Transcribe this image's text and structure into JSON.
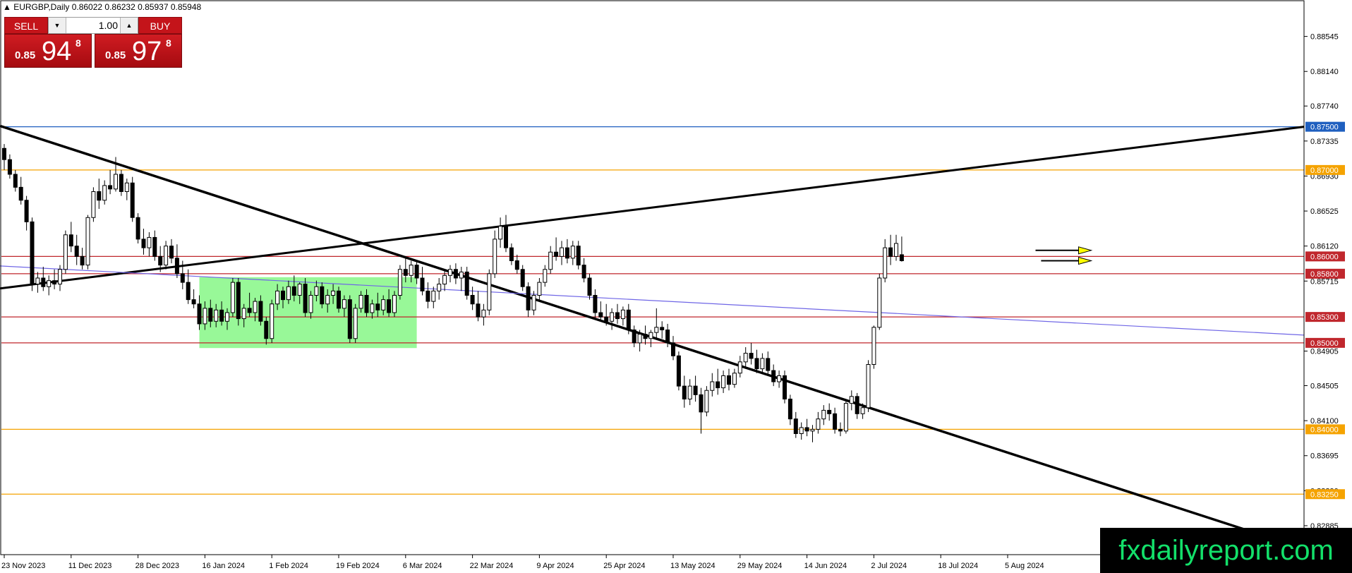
{
  "header": {
    "symbol_line": "EURGBP,Daily  0.86022 0.86232 0.85937 0.85948"
  },
  "trade_panel": {
    "sell_label": "SELL",
    "buy_label": "BUY",
    "lot_value": "1.00",
    "sell_price": {
      "prefix": "0.85",
      "big": "94",
      "sup": "8"
    },
    "buy_price": {
      "prefix": "0.85",
      "big": "97",
      "sup": "8"
    }
  },
  "watermark": "fxdailyreport.com",
  "colors": {
    "bull_body": "#ffffff",
    "bear_body": "#000000",
    "horizontal_red": "#c0272d",
    "horizontal_orange": "#f5a300",
    "horizontal_blue": "#1f5fbf",
    "trend_blue": "#6f66e6",
    "zone_green": "#98f898",
    "arrow_yellow": "#ffff00"
  },
  "chart_data": {
    "type": "candlestick",
    "symbol": "EURGBP",
    "timeframe": "Daily",
    "ylim": [
      0.8255,
      0.8895
    ],
    "y_ticks": [
      "0.88545",
      "0.88140",
      "0.87740",
      "0.87335",
      "0.86930",
      "0.86525",
      "0.86120",
      "0.85715",
      "0.84905",
      "0.84505",
      "0.84100",
      "0.83695",
      "0.83290",
      "0.82885"
    ],
    "x_ticks": [
      {
        "label": "23 Nov 2023",
        "bar": 0
      },
      {
        "label": "11 Dec 2023",
        "bar": 12
      },
      {
        "label": "28 Dec 2023",
        "bar": 24
      },
      {
        "label": "16 Jan 2024",
        "bar": 36
      },
      {
        "label": "1 Feb 2024",
        "bar": 48
      },
      {
        "label": "19 Feb 2024",
        "bar": 60
      },
      {
        "label": "6 Mar 2024",
        "bar": 72
      },
      {
        "label": "22 Mar 2024",
        "bar": 84
      },
      {
        "label": "9 Apr 2024",
        "bar": 96
      },
      {
        "label": "25 Apr 2024",
        "bar": 108
      },
      {
        "label": "13 May 2024",
        "bar": 120
      },
      {
        "label": "29 May 2024",
        "bar": 132
      },
      {
        "label": "14 Jun 2024",
        "bar": 144
      },
      {
        "label": "2 Jul 2024",
        "bar": 156
      },
      {
        "label": "18 Jul 2024",
        "bar": 168
      },
      {
        "label": "5 Aug 2024",
        "bar": 180
      }
    ],
    "horizontal_levels": [
      {
        "value": 0.875,
        "label": "0.87500",
        "color": "#1f5fbf"
      },
      {
        "value": 0.87,
        "label": "0.87000",
        "color": "#f5a300"
      },
      {
        "value": 0.86,
        "label": "0.86000",
        "color": "#c0272d"
      },
      {
        "value": 0.858,
        "label": "0.85800",
        "color": "#c0272d"
      },
      {
        "value": 0.853,
        "label": "0.85300",
        "color": "#c0272d"
      },
      {
        "value": 0.85,
        "label": "0.85000",
        "color": "#c0272d"
      },
      {
        "value": 0.84,
        "label": "0.84000",
        "color": "#f5a300"
      },
      {
        "value": 0.8325,
        "label": "0.83250",
        "color": "#f5a300"
      }
    ],
    "trendlines": [
      {
        "color": "#000000",
        "width": 3.5,
        "from": [
          0,
          0.8751
        ],
        "to": [
          1840,
          0.8264
        ]
      },
      {
        "color": "#000000",
        "width": 3,
        "from": [
          0,
          0.8563
        ],
        "to": [
          1848,
          0.875
        ]
      },
      {
        "color": "#6f66e6",
        "width": 1.2,
        "from": [
          0,
          0.8589
        ],
        "to": [
          1848,
          0.8509
        ]
      }
    ],
    "zone": {
      "from_bar": 35,
      "to_bar": 74,
      "top": 0.8576,
      "bottom": 0.8494
    },
    "arrows": [
      {
        "from_bar": 185,
        "to_bar": 195,
        "value": 0.8607
      },
      {
        "from_bar": 186,
        "to_bar": 195,
        "value": 0.8595
      }
    ],
    "candles": [
      {
        "o": 0.8725,
        "h": 0.873,
        "l": 0.87,
        "c": 0.8712
      },
      {
        "o": 0.8712,
        "h": 0.8718,
        "l": 0.869,
        "c": 0.8695
      },
      {
        "o": 0.8695,
        "h": 0.87,
        "l": 0.8675,
        "c": 0.868
      },
      {
        "o": 0.868,
        "h": 0.8692,
        "l": 0.866,
        "c": 0.8665
      },
      {
        "o": 0.8665,
        "h": 0.867,
        "l": 0.863,
        "c": 0.864
      },
      {
        "o": 0.864,
        "h": 0.8645,
        "l": 0.856,
        "c": 0.8568
      },
      {
        "o": 0.8568,
        "h": 0.8582,
        "l": 0.8558,
        "c": 0.8575
      },
      {
        "o": 0.8575,
        "h": 0.8588,
        "l": 0.856,
        "c": 0.8565
      },
      {
        "o": 0.8565,
        "h": 0.8578,
        "l": 0.8555,
        "c": 0.8572
      },
      {
        "o": 0.8572,
        "h": 0.8585,
        "l": 0.8562,
        "c": 0.8568
      },
      {
        "o": 0.8568,
        "h": 0.859,
        "l": 0.856,
        "c": 0.8585
      },
      {
        "o": 0.8585,
        "h": 0.863,
        "l": 0.858,
        "c": 0.8625
      },
      {
        "o": 0.8625,
        "h": 0.864,
        "l": 0.8605,
        "c": 0.8612
      },
      {
        "o": 0.8612,
        "h": 0.8625,
        "l": 0.859,
        "c": 0.86
      },
      {
        "o": 0.86,
        "h": 0.861,
        "l": 0.8585,
        "c": 0.859
      },
      {
        "o": 0.859,
        "h": 0.8648,
        "l": 0.8585,
        "c": 0.8645
      },
      {
        "o": 0.8645,
        "h": 0.868,
        "l": 0.864,
        "c": 0.8675
      },
      {
        "o": 0.8675,
        "h": 0.869,
        "l": 0.8655,
        "c": 0.8665
      },
      {
        "o": 0.8665,
        "h": 0.8688,
        "l": 0.866,
        "c": 0.8682
      },
      {
        "o": 0.8682,
        "h": 0.87,
        "l": 0.8672,
        "c": 0.8678
      },
      {
        "o": 0.8678,
        "h": 0.8715,
        "l": 0.8675,
        "c": 0.8695
      },
      {
        "o": 0.8695,
        "h": 0.87,
        "l": 0.867,
        "c": 0.8675
      },
      {
        "o": 0.8675,
        "h": 0.869,
        "l": 0.8665,
        "c": 0.8685
      },
      {
        "o": 0.8685,
        "h": 0.8692,
        "l": 0.864,
        "c": 0.8645
      },
      {
        "o": 0.8645,
        "h": 0.865,
        "l": 0.8615,
        "c": 0.862
      },
      {
        "o": 0.862,
        "h": 0.8632,
        "l": 0.8602,
        "c": 0.861
      },
      {
        "o": 0.861,
        "h": 0.8628,
        "l": 0.86,
        "c": 0.8622
      },
      {
        "o": 0.8622,
        "h": 0.863,
        "l": 0.8595,
        "c": 0.86
      },
      {
        "o": 0.86,
        "h": 0.8612,
        "l": 0.8582,
        "c": 0.859
      },
      {
        "o": 0.859,
        "h": 0.8618,
        "l": 0.8585,
        "c": 0.8612
      },
      {
        "o": 0.8612,
        "h": 0.862,
        "l": 0.8592,
        "c": 0.8598
      },
      {
        "o": 0.8598,
        "h": 0.8614,
        "l": 0.8575,
        "c": 0.858
      },
      {
        "o": 0.858,
        "h": 0.8595,
        "l": 0.8562,
        "c": 0.857
      },
      {
        "o": 0.857,
        "h": 0.8585,
        "l": 0.8545,
        "c": 0.855
      },
      {
        "o": 0.855,
        "h": 0.8562,
        "l": 0.854,
        "c": 0.8545
      },
      {
        "o": 0.8545,
        "h": 0.8555,
        "l": 0.8515,
        "c": 0.8522
      },
      {
        "o": 0.8522,
        "h": 0.8548,
        "l": 0.8515,
        "c": 0.854
      },
      {
        "o": 0.854,
        "h": 0.855,
        "l": 0.8518,
        "c": 0.8525
      },
      {
        "o": 0.8525,
        "h": 0.8545,
        "l": 0.8518,
        "c": 0.8538
      },
      {
        "o": 0.8538,
        "h": 0.8548,
        "l": 0.852,
        "c": 0.8525
      },
      {
        "o": 0.8525,
        "h": 0.854,
        "l": 0.8515,
        "c": 0.8535
      },
      {
        "o": 0.8535,
        "h": 0.8575,
        "l": 0.853,
        "c": 0.857
      },
      {
        "o": 0.857,
        "h": 0.8575,
        "l": 0.852,
        "c": 0.8528
      },
      {
        "o": 0.8528,
        "h": 0.8545,
        "l": 0.8518,
        "c": 0.854
      },
      {
        "o": 0.854,
        "h": 0.8558,
        "l": 0.853,
        "c": 0.8535
      },
      {
        "o": 0.8535,
        "h": 0.8552,
        "l": 0.8525,
        "c": 0.8548
      },
      {
        "o": 0.8548,
        "h": 0.8555,
        "l": 0.852,
        "c": 0.8525
      },
      {
        "o": 0.8525,
        "h": 0.853,
        "l": 0.8498,
        "c": 0.8505
      },
      {
        "o": 0.8505,
        "h": 0.855,
        "l": 0.85,
        "c": 0.8545
      },
      {
        "o": 0.8545,
        "h": 0.8568,
        "l": 0.8538,
        "c": 0.856
      },
      {
        "o": 0.856,
        "h": 0.8565,
        "l": 0.854,
        "c": 0.855
      },
      {
        "o": 0.855,
        "h": 0.8572,
        "l": 0.8545,
        "c": 0.8565
      },
      {
        "o": 0.8565,
        "h": 0.8578,
        "l": 0.8548,
        "c": 0.8555
      },
      {
        "o": 0.8555,
        "h": 0.857,
        "l": 0.8545,
        "c": 0.8568
      },
      {
        "o": 0.8568,
        "h": 0.8575,
        "l": 0.853,
        "c": 0.8535
      },
      {
        "o": 0.8535,
        "h": 0.856,
        "l": 0.8528,
        "c": 0.8555
      },
      {
        "o": 0.8555,
        "h": 0.8572,
        "l": 0.8548,
        "c": 0.8565
      },
      {
        "o": 0.8565,
        "h": 0.857,
        "l": 0.854,
        "c": 0.8545
      },
      {
        "o": 0.8545,
        "h": 0.8562,
        "l": 0.8535,
        "c": 0.8555
      },
      {
        "o": 0.8555,
        "h": 0.8568,
        "l": 0.8545,
        "c": 0.856
      },
      {
        "o": 0.856,
        "h": 0.8565,
        "l": 0.8535,
        "c": 0.854
      },
      {
        "o": 0.854,
        "h": 0.8555,
        "l": 0.853,
        "c": 0.855
      },
      {
        "o": 0.855,
        "h": 0.8555,
        "l": 0.85,
        "c": 0.8505
      },
      {
        "o": 0.8505,
        "h": 0.8545,
        "l": 0.85,
        "c": 0.854
      },
      {
        "o": 0.854,
        "h": 0.856,
        "l": 0.8535,
        "c": 0.8555
      },
      {
        "o": 0.8555,
        "h": 0.8562,
        "l": 0.853,
        "c": 0.8535
      },
      {
        "o": 0.8535,
        "h": 0.855,
        "l": 0.8528,
        "c": 0.8545
      },
      {
        "o": 0.8545,
        "h": 0.8558,
        "l": 0.853,
        "c": 0.8538
      },
      {
        "o": 0.8538,
        "h": 0.8555,
        "l": 0.8532,
        "c": 0.855
      },
      {
        "o": 0.855,
        "h": 0.8562,
        "l": 0.853,
        "c": 0.8535
      },
      {
        "o": 0.8535,
        "h": 0.856,
        "l": 0.853,
        "c": 0.8555
      },
      {
        "o": 0.8555,
        "h": 0.859,
        "l": 0.855,
        "c": 0.8585
      },
      {
        "o": 0.8585,
        "h": 0.8598,
        "l": 0.857,
        "c": 0.8578
      },
      {
        "o": 0.8578,
        "h": 0.8595,
        "l": 0.857,
        "c": 0.859
      },
      {
        "o": 0.859,
        "h": 0.8595,
        "l": 0.8568,
        "c": 0.8575
      },
      {
        "o": 0.8575,
        "h": 0.8588,
        "l": 0.8555,
        "c": 0.856
      },
      {
        "o": 0.856,
        "h": 0.857,
        "l": 0.854,
        "c": 0.8548
      },
      {
        "o": 0.8548,
        "h": 0.8565,
        "l": 0.854,
        "c": 0.856
      },
      {
        "o": 0.856,
        "h": 0.8575,
        "l": 0.855,
        "c": 0.8568
      },
      {
        "o": 0.8568,
        "h": 0.8585,
        "l": 0.856,
        "c": 0.8578
      },
      {
        "o": 0.8578,
        "h": 0.859,
        "l": 0.857,
        "c": 0.8585
      },
      {
        "o": 0.8585,
        "h": 0.8592,
        "l": 0.8568,
        "c": 0.8575
      },
      {
        "o": 0.8575,
        "h": 0.8588,
        "l": 0.856,
        "c": 0.8582
      },
      {
        "o": 0.8582,
        "h": 0.8588,
        "l": 0.855,
        "c": 0.8555
      },
      {
        "o": 0.8555,
        "h": 0.8565,
        "l": 0.8538,
        "c": 0.8545
      },
      {
        "o": 0.8545,
        "h": 0.856,
        "l": 0.8525,
        "c": 0.853
      },
      {
        "o": 0.853,
        "h": 0.8545,
        "l": 0.852,
        "c": 0.8538
      },
      {
        "o": 0.8538,
        "h": 0.8585,
        "l": 0.8532,
        "c": 0.858
      },
      {
        "o": 0.858,
        "h": 0.863,
        "l": 0.8575,
        "c": 0.862
      },
      {
        "o": 0.862,
        "h": 0.8645,
        "l": 0.861,
        "c": 0.8635
      },
      {
        "o": 0.8635,
        "h": 0.8648,
        "l": 0.8605,
        "c": 0.861
      },
      {
        "o": 0.861,
        "h": 0.8615,
        "l": 0.859,
        "c": 0.8595
      },
      {
        "o": 0.8595,
        "h": 0.8602,
        "l": 0.858,
        "c": 0.8585
      },
      {
        "o": 0.8585,
        "h": 0.859,
        "l": 0.856,
        "c": 0.8565
      },
      {
        "o": 0.8565,
        "h": 0.857,
        "l": 0.853,
        "c": 0.8538
      },
      {
        "o": 0.8538,
        "h": 0.856,
        "l": 0.8532,
        "c": 0.8555
      },
      {
        "o": 0.8555,
        "h": 0.8575,
        "l": 0.8548,
        "c": 0.857
      },
      {
        "o": 0.857,
        "h": 0.859,
        "l": 0.8565,
        "c": 0.8585
      },
      {
        "o": 0.8585,
        "h": 0.8612,
        "l": 0.858,
        "c": 0.8605
      },
      {
        "o": 0.8605,
        "h": 0.8622,
        "l": 0.8595,
        "c": 0.86
      },
      {
        "o": 0.86,
        "h": 0.8618,
        "l": 0.859,
        "c": 0.861
      },
      {
        "o": 0.861,
        "h": 0.862,
        "l": 0.8592,
        "c": 0.8598
      },
      {
        "o": 0.8598,
        "h": 0.8618,
        "l": 0.859,
        "c": 0.8612
      },
      {
        "o": 0.8612,
        "h": 0.8618,
        "l": 0.8585,
        "c": 0.859
      },
      {
        "o": 0.859,
        "h": 0.8598,
        "l": 0.857,
        "c": 0.8575
      },
      {
        "o": 0.8575,
        "h": 0.858,
        "l": 0.855,
        "c": 0.8555
      },
      {
        "o": 0.8555,
        "h": 0.8562,
        "l": 0.8528,
        "c": 0.8535
      },
      {
        "o": 0.8535,
        "h": 0.8548,
        "l": 0.8525,
        "c": 0.853
      },
      {
        "o": 0.853,
        "h": 0.8545,
        "l": 0.852,
        "c": 0.8525
      },
      {
        "o": 0.8525,
        "h": 0.854,
        "l": 0.8515,
        "c": 0.8535
      },
      {
        "o": 0.8535,
        "h": 0.8545,
        "l": 0.8522,
        "c": 0.8528
      },
      {
        "o": 0.8528,
        "h": 0.8542,
        "l": 0.852,
        "c": 0.8538
      },
      {
        "o": 0.8538,
        "h": 0.8545,
        "l": 0.851,
        "c": 0.8515
      },
      {
        "o": 0.8515,
        "h": 0.852,
        "l": 0.8495,
        "c": 0.85
      },
      {
        "o": 0.85,
        "h": 0.8515,
        "l": 0.849,
        "c": 0.851
      },
      {
        "o": 0.851,
        "h": 0.852,
        "l": 0.8498,
        "c": 0.8505
      },
      {
        "o": 0.8505,
        "h": 0.8515,
        "l": 0.8495,
        "c": 0.8512
      },
      {
        "o": 0.8512,
        "h": 0.854,
        "l": 0.8505,
        "c": 0.8518
      },
      {
        "o": 0.8518,
        "h": 0.8525,
        "l": 0.8505,
        "c": 0.8515
      },
      {
        "o": 0.8515,
        "h": 0.8522,
        "l": 0.8495,
        "c": 0.85
      },
      {
        "o": 0.85,
        "h": 0.8508,
        "l": 0.848,
        "c": 0.8485
      },
      {
        "o": 0.8485,
        "h": 0.849,
        "l": 0.8445,
        "c": 0.845
      },
      {
        "o": 0.845,
        "h": 0.8462,
        "l": 0.8425,
        "c": 0.8435
      },
      {
        "o": 0.8435,
        "h": 0.8458,
        "l": 0.8428,
        "c": 0.845
      },
      {
        "o": 0.845,
        "h": 0.8462,
        "l": 0.8432,
        "c": 0.844
      },
      {
        "o": 0.844,
        "h": 0.8448,
        "l": 0.8395,
        "c": 0.842
      },
      {
        "o": 0.842,
        "h": 0.845,
        "l": 0.8415,
        "c": 0.8445
      },
      {
        "o": 0.8445,
        "h": 0.8465,
        "l": 0.8438,
        "c": 0.8455
      },
      {
        "o": 0.8455,
        "h": 0.847,
        "l": 0.844,
        "c": 0.8448
      },
      {
        "o": 0.8448,
        "h": 0.8468,
        "l": 0.8442,
        "c": 0.8462
      },
      {
        "o": 0.8462,
        "h": 0.847,
        "l": 0.8445,
        "c": 0.8452
      },
      {
        "o": 0.8452,
        "h": 0.847,
        "l": 0.8448,
        "c": 0.8465
      },
      {
        "o": 0.8465,
        "h": 0.8485,
        "l": 0.846,
        "c": 0.8478
      },
      {
        "o": 0.8478,
        "h": 0.8495,
        "l": 0.847,
        "c": 0.8488
      },
      {
        "o": 0.8488,
        "h": 0.85,
        "l": 0.8475,
        "c": 0.8482
      },
      {
        "o": 0.8482,
        "h": 0.8492,
        "l": 0.8465,
        "c": 0.847
      },
      {
        "o": 0.847,
        "h": 0.8488,
        "l": 0.8465,
        "c": 0.8482
      },
      {
        "o": 0.8482,
        "h": 0.849,
        "l": 0.8462,
        "c": 0.8468
      },
      {
        "o": 0.8468,
        "h": 0.8475,
        "l": 0.845,
        "c": 0.8455
      },
      {
        "o": 0.8455,
        "h": 0.8468,
        "l": 0.8448,
        "c": 0.8462
      },
      {
        "o": 0.8462,
        "h": 0.8468,
        "l": 0.843,
        "c": 0.8435
      },
      {
        "o": 0.8435,
        "h": 0.844,
        "l": 0.8405,
        "c": 0.8412
      },
      {
        "o": 0.8412,
        "h": 0.842,
        "l": 0.839,
        "c": 0.8395
      },
      {
        "o": 0.8395,
        "h": 0.8408,
        "l": 0.8388,
        "c": 0.8402
      },
      {
        "o": 0.8402,
        "h": 0.8412,
        "l": 0.8392,
        "c": 0.8398
      },
      {
        "o": 0.8398,
        "h": 0.8405,
        "l": 0.8385,
        "c": 0.84
      },
      {
        "o": 0.84,
        "h": 0.842,
        "l": 0.8395,
        "c": 0.8412
      },
      {
        "o": 0.8412,
        "h": 0.8428,
        "l": 0.8405,
        "c": 0.8422
      },
      {
        "o": 0.8422,
        "h": 0.843,
        "l": 0.841,
        "c": 0.8418
      },
      {
        "o": 0.8418,
        "h": 0.8425,
        "l": 0.8395,
        "c": 0.84
      },
      {
        "o": 0.84,
        "h": 0.8408,
        "l": 0.8392,
        "c": 0.8398
      },
      {
        "o": 0.8398,
        "h": 0.8435,
        "l": 0.8395,
        "c": 0.843
      },
      {
        "o": 0.843,
        "h": 0.8445,
        "l": 0.8422,
        "c": 0.8438
      },
      {
        "o": 0.8438,
        "h": 0.8442,
        "l": 0.8412,
        "c": 0.8418
      },
      {
        "o": 0.8418,
        "h": 0.843,
        "l": 0.8412,
        "c": 0.8425
      },
      {
        "o": 0.8425,
        "h": 0.848,
        "l": 0.842,
        "c": 0.8475
      },
      {
        "o": 0.8475,
        "h": 0.852,
        "l": 0.847,
        "c": 0.8518
      },
      {
        "o": 0.8518,
        "h": 0.858,
        "l": 0.8515,
        "c": 0.8575
      },
      {
        "o": 0.8575,
        "h": 0.862,
        "l": 0.857,
        "c": 0.861
      },
      {
        "o": 0.861,
        "h": 0.8625,
        "l": 0.859,
        "c": 0.86
      },
      {
        "o": 0.86,
        "h": 0.8625,
        "l": 0.8595,
        "c": 0.8615
      },
      {
        "o": 0.8602,
        "h": 0.8623,
        "l": 0.8594,
        "c": 0.8595
      }
    ]
  }
}
